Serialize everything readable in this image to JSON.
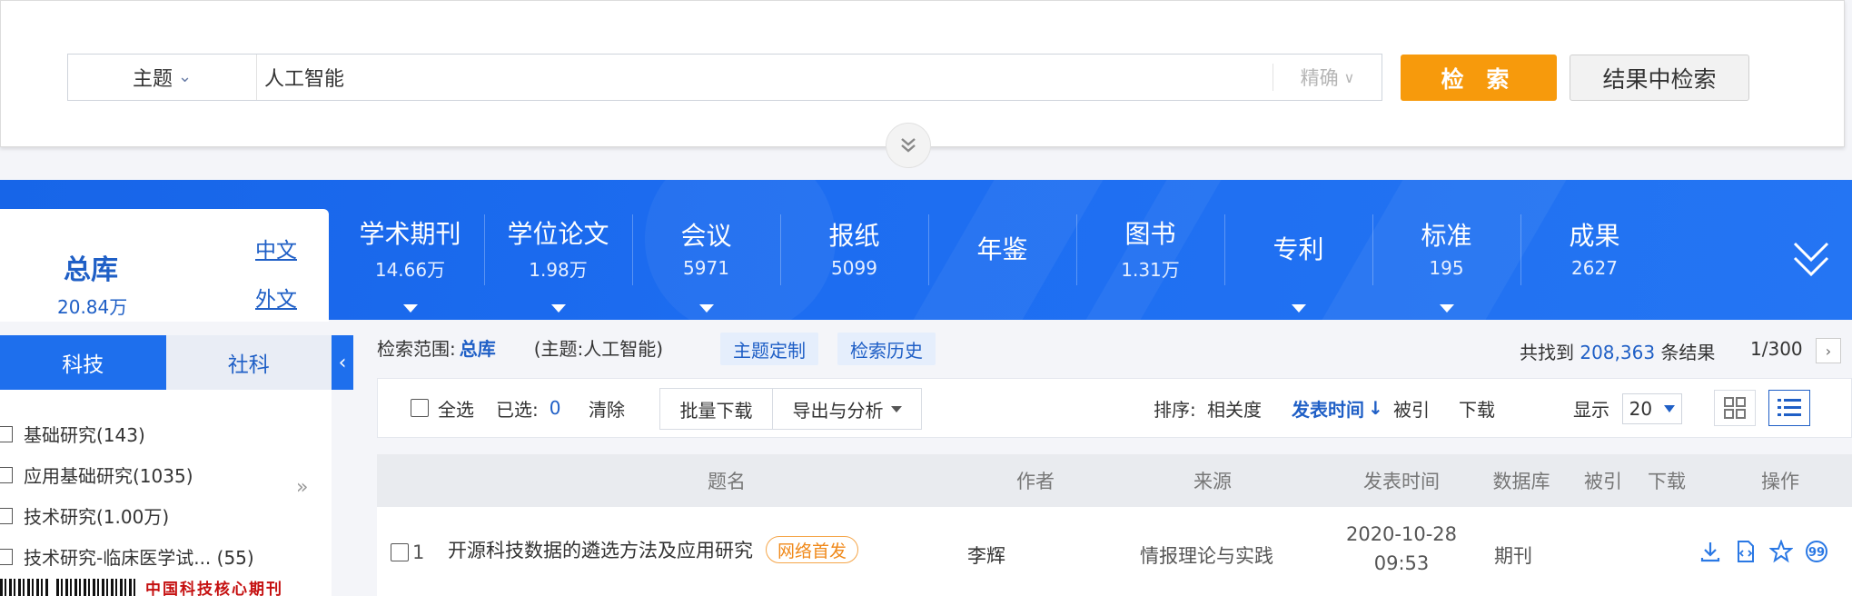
{
  "search": {
    "field": "主题",
    "query": "人工智能",
    "match": "精确",
    "search_button": "检 索",
    "result_search_button": "结果中检索"
  },
  "library": {
    "title": "总库",
    "count": "20.84万",
    "lang_cn": "中文",
    "lang_en": "外文"
  },
  "categories": [
    {
      "name": "学术期刊",
      "count": "14.66万",
      "dropdown": true
    },
    {
      "name": "学位论文",
      "count": "1.98万",
      "dropdown": true
    },
    {
      "name": "会议",
      "count": "5971",
      "dropdown": true
    },
    {
      "name": "报纸",
      "count": "5099",
      "dropdown": false
    },
    {
      "name": "年鉴",
      "count": "",
      "dropdown": false
    },
    {
      "name": "图书",
      "count": "1.31万",
      "dropdown": false
    },
    {
      "name": "专利",
      "count": "",
      "dropdown": true
    },
    {
      "name": "标准",
      "count": "195",
      "dropdown": true
    },
    {
      "name": "成果",
      "count": "2627",
      "dropdown": false
    }
  ],
  "side_tabs": {
    "active": "科技",
    "inactive": "社科"
  },
  "side_items": [
    {
      "label": "基础研究(143)"
    },
    {
      "label": "应用基础研究(1035)"
    },
    {
      "label": "技术研究(1.00万)"
    },
    {
      "label": "技术研究-临床医学试...  (55)"
    }
  ],
  "side_more": "»",
  "journal_logo": "中国科技核心期刊",
  "scope": {
    "label": "检索范围:",
    "lib": "总库",
    "query": "(主题:人工智能)",
    "chip_custom": "主题定制",
    "chip_history": "检索历史"
  },
  "found": {
    "prefix": "共找到",
    "count": "208,363",
    "suffix": "条结果",
    "page": "1/300"
  },
  "toolbar": {
    "select_all": "全选",
    "selected_label": "已选:",
    "selected_count": "0",
    "clear": "清除",
    "batch_download": "批量下载",
    "export": "导出与分析",
    "sort_label": "排序:",
    "sort_relevance": "相关度",
    "sort_date": "发表时间",
    "sort_cited": "被引",
    "sort_download": "下载",
    "display_label": "显示",
    "display_value": "20"
  },
  "table": {
    "headers": [
      "题名",
      "作者",
      "来源",
      "发表时间",
      "数据库",
      "被引",
      "下载",
      "操作"
    ],
    "rows": [
      {
        "index": "1",
        "title": "开源科技数据的遴选方法及应用研究",
        "badge": "网络首发",
        "author": "李辉",
        "source": "情报理论与实践",
        "date": "2020-10-28",
        "time": "09:53",
        "db": "期刊"
      }
    ]
  },
  "colors": {
    "banner": "#1d6df1",
    "accent": "#1f5fc6",
    "search_button": "#f79a0c",
    "badge": "#f0891a"
  },
  "icons": {
    "row_ops": [
      "download-icon",
      "html-read-icon",
      "favorite-star-icon",
      "cite-icon"
    ]
  }
}
